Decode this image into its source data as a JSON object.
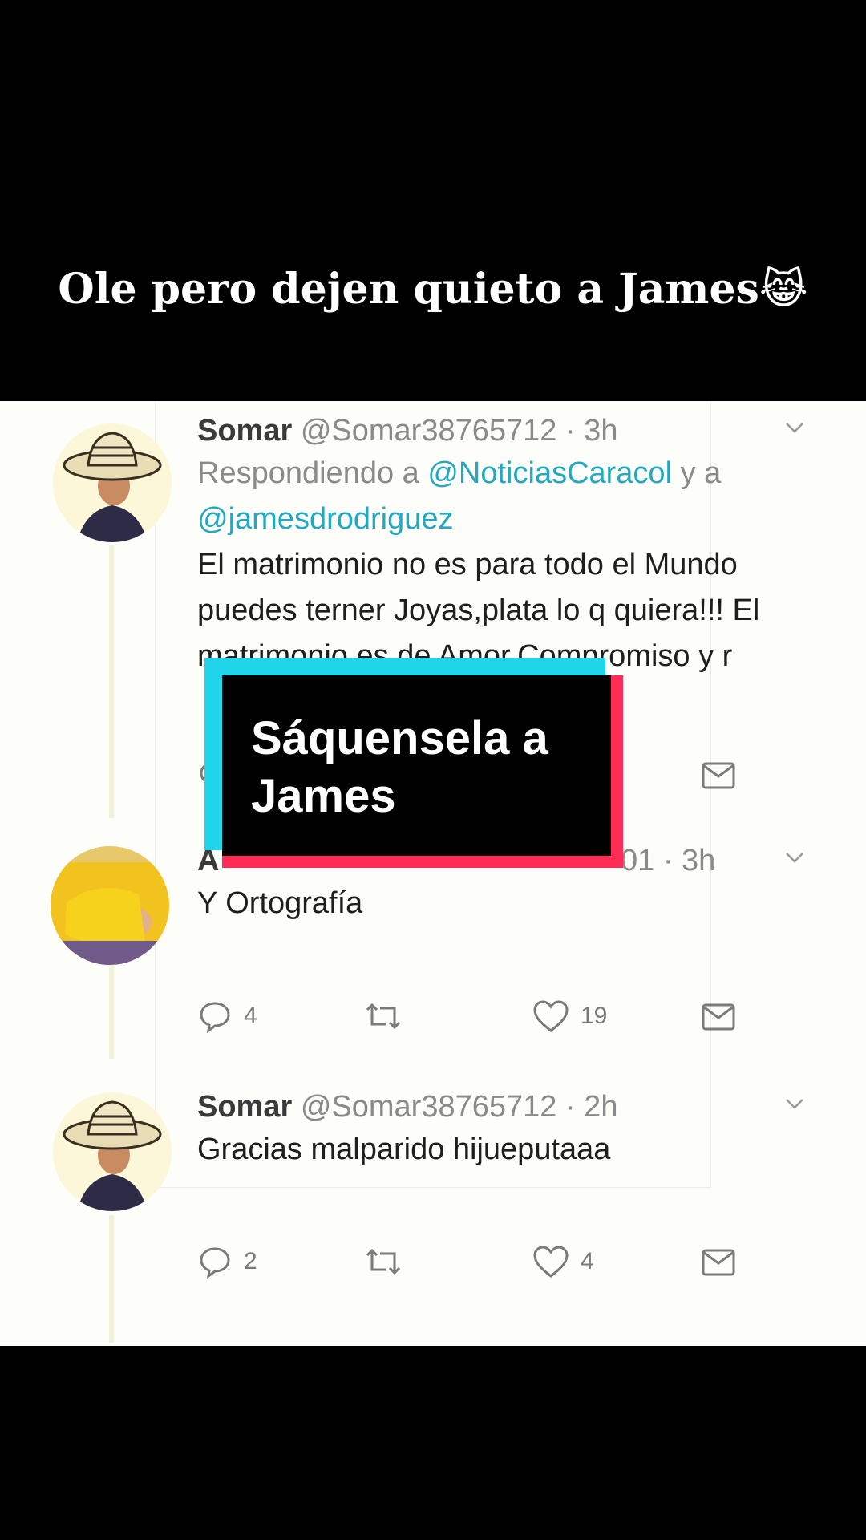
{
  "caption": "Ole pero dejen quieto a James",
  "caption_emoji": "😹",
  "overlay_text": "Sáquensela a James",
  "tweets": [
    {
      "name": "Somar",
      "handle_time": "@Somar38765712 · 3h",
      "replying_prefix": "Respondiendo a ",
      "replying_mention1": "@NoticiasCaracol",
      "replying_and": " y a",
      "replying_mention2": "@jamesdrodriguez",
      "text": "El matrimonio no es para todo el Mundo puedes terner Joyas,plata lo q quiera!!! El matrimonio es de Amor,Compromiso y r",
      "avatar": "sombrero-vueltiao-man"
    },
    {
      "name": "A",
      "handle_time": "01 · 3h",
      "text": "Y Ortografía",
      "replies": "4",
      "likes": "19",
      "avatar": "baby-in-yellow-jersey"
    },
    {
      "name": "Somar",
      "handle_time": "@Somar38765712 · 2h",
      "text": "Gracias malparido hijueputaaa",
      "replies": "2",
      "likes": "4",
      "avatar": "sombrero-vueltiao-man"
    }
  ],
  "icons": [
    "reply-icon",
    "retweet-icon",
    "like-icon",
    "message-icon",
    "chevron-down-icon"
  ],
  "colors": {
    "mention": "#24a8c0",
    "overlay_cyan": "#20d5ea",
    "overlay_red": "#ff2c55"
  }
}
